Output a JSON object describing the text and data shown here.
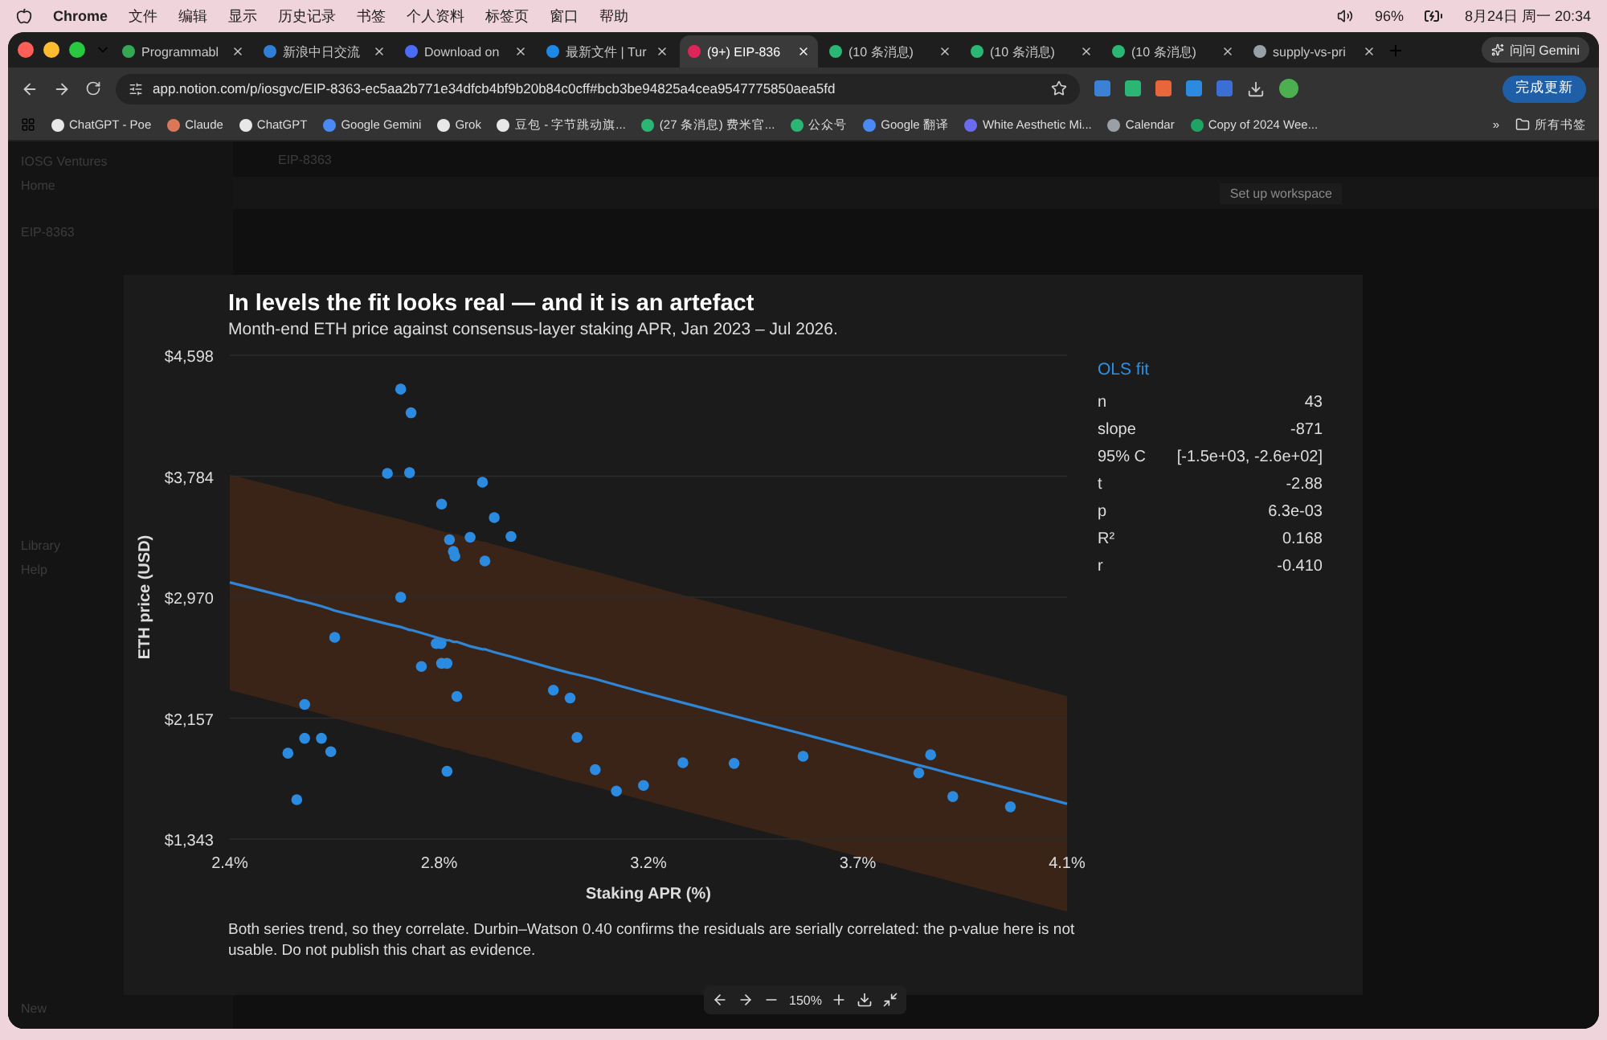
{
  "menu_bar": {
    "app": "Chrome",
    "menus": [
      "文件",
      "编辑",
      "显示",
      "历史记录",
      "书签",
      "个人资料",
      "标签页",
      "窗口",
      "帮助"
    ],
    "battery": "96%",
    "clock": "8月24日 周一 20:34"
  },
  "tabs": [
    {
      "title": "Programmabl",
      "color": "#34a853",
      "selected": false
    },
    {
      "title": "新浪中日交流",
      "color": "#2f7ed8",
      "selected": false
    },
    {
      "title": "Download on",
      "color": "#4a6cf7",
      "selected": false
    },
    {
      "title": "最新文件 | Tur",
      "color": "#1e88e5",
      "selected": false
    },
    {
      "title": "(9+) EIP-836",
      "color": "#e0245e",
      "selected": true
    },
    {
      "title": "(10 条消息)",
      "color": "#2bb673",
      "selected": false
    },
    {
      "title": "(10 条消息)",
      "color": "#2bb673",
      "selected": false
    },
    {
      "title": "(10 条消息)",
      "color": "#2bb673",
      "selected": false
    },
    {
      "title": "supply-vs-pri",
      "color": "#9aa0a6",
      "selected": false
    }
  ],
  "gemini_button": "问问 Gemini",
  "address_bar": {
    "url": "app.notion.com/p/iosgvc/EIP-8363-ec5aa2b771e34dfcb4bf9b20b84c0cff#bcb3be94825a4cea9547775850aea5fd"
  },
  "update_button": "完成更新",
  "bookmarks": [
    {
      "title": "ChatGPT - Poe",
      "color": "#e8e8e8"
    },
    {
      "title": "Claude",
      "color": "#d97757"
    },
    {
      "title": "ChatGPT",
      "color": "#e8e8e8"
    },
    {
      "title": "Google Gemini",
      "color": "#4a8af4"
    },
    {
      "title": "Grok",
      "color": "#e8e8e8"
    },
    {
      "title": "豆包 - 字节跳动旗...",
      "color": "#e8e8e8"
    },
    {
      "title": "(27 条消息) 费米官...",
      "color": "#2bb673"
    },
    {
      "title": "公众号",
      "color": "#2bb673"
    },
    {
      "title": "Google 翻译",
      "color": "#4a8af4"
    },
    {
      "title": "White Aesthetic Mi...",
      "color": "#6b6bf0"
    },
    {
      "title": "Calendar",
      "color": "#9aa0a6"
    },
    {
      "title": "Copy of 2024 Wee...",
      "color": "#1fa463"
    }
  ],
  "bookmarks_more": "»",
  "all_bookmarks": "所有书签",
  "notion": {
    "workspace": "IOSG Ventures",
    "crumb": "EIP-8363",
    "sidebar": [
      {
        "label": "Home"
      },
      {
        "label": "EIP-8363"
      },
      {
        "label": "Library"
      },
      {
        "label": "Help"
      }
    ],
    "banner_button": "Set up workspace",
    "new_button": "New"
  },
  "lightbox": {
    "title": "In levels the fit looks real — and it is an artefact",
    "subtitle": "Month-end ETH price against consensus-layer staking APR, Jan 2023 – Jul 2026.",
    "chart_data": {
      "type": "scatter",
      "xlabel": "Staking APR (%)",
      "ylabel": "ETH price (USD)",
      "x": [
        2.747,
        2.768,
        2.72,
        2.765,
        2.913,
        2.83,
        2.937,
        2.846,
        2.888,
        2.971,
        2.854,
        2.857,
        2.918,
        2.747,
        2.613,
        2.819,
        2.829,
        2.789,
        2.83,
        2.841,
        2.861,
        2.552,
        3.057,
        3.091,
        2.518,
        2.552,
        2.586,
        2.605,
        3.105,
        2.536,
        2.841,
        3.142,
        3.185,
        3.24,
        3.32,
        3.424,
        3.564,
        3.799,
        3.823,
        3.868,
        3.985,
        2.4,
        4.1
      ],
      "series": [
        {
          "type": "scatter",
          "color": "#2a8be0",
          "values": [
            4370,
            4211,
            3803,
            3808,
            3744,
            3596,
            3506,
            3357,
            3373,
            3379,
            3278,
            3246,
            3214,
            2970,
            2700,
            2658,
            2658,
            2504,
            2525,
            2525,
            2303,
            2249,
            2345,
            2292,
            1921,
            2021,
            2021,
            1931,
            2027,
            1608,
            1799,
            1810,
            1666,
            1704,
            1857,
            1852,
            1900,
            1788,
            1910,
            1629,
            1560,
            null,
            null
          ]
        },
        {
          "type": "line",
          "color": "#2f86d6",
          "values": [
            2770,
            2750,
            2790,
            2750,
            2620,
            2690,
            2600,
            2680,
            2640,
            2570,
            2670,
            2670,
            2620,
            2770,
            2880,
            2700,
            2690,
            2730,
            2690,
            2680,
            2670,
            2940,
            2490,
            2460,
            2970,
            2940,
            2910,
            2890,
            2450,
            2950,
            2680,
            2420,
            2380,
            2330,
            2260,
            2170,
            2050,
            1840,
            1820,
            1780,
            1680,
            3070,
            1580
          ]
        }
      ],
      "grid": true,
      "xlim": [
        2.4,
        4.1
      ],
      "ylim": [
        1343,
        4598
      ],
      "xticks": [
        {
          "value": 2.4,
          "label": "2.4%"
        },
        {
          "value": 2.825,
          "label": "2.8%"
        },
        {
          "value": 3.25,
          "label": "3.2%"
        },
        {
          "value": 3.675,
          "label": "3.7%"
        },
        {
          "value": 4.1,
          "label": "4.1%"
        }
      ],
      "yticks": [
        {
          "value": 1343,
          "label": "$1,343"
        },
        {
          "value": 2156.75,
          "label": "$2,157"
        },
        {
          "value": 2970.5,
          "label": "$2,970"
        },
        {
          "value": 3784.25,
          "label": "$3,784"
        },
        {
          "value": 4598,
          "label": "$4,598"
        }
      ]
    },
    "stats": {
      "title": "OLS fit",
      "rows": [
        {
          "label": "n",
          "value": "43"
        },
        {
          "label": "slope",
          "value": "-871"
        },
        {
          "label": "95% C",
          "value": "[-1.5e+03, -2.6e+02]"
        },
        {
          "label": "t",
          "value": "-2.88"
        },
        {
          "label": "p",
          "value": "6.3e-03"
        },
        {
          "label": "R²",
          "value": "0.168"
        },
        {
          "label": "r",
          "value": "-0.410"
        }
      ]
    },
    "caption": "Both series trend, so they correlate. Durbin–Watson 0.40 confirms the residuals are serially correlated: the p-value here is not usable. Do not publish this chart as evidence.",
    "zoom": "150%"
  }
}
